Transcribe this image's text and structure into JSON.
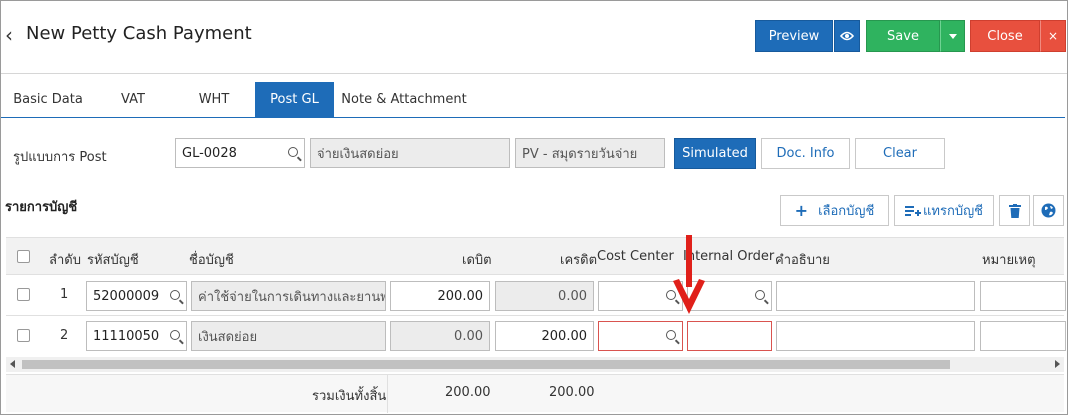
{
  "header": {
    "back_icon": "‹",
    "title": "New Petty Cash Payment",
    "preview_label": "Preview",
    "save_label": "Save",
    "close_label": "Close",
    "close_x": "×"
  },
  "tabs": [
    {
      "label": "Basic Data"
    },
    {
      "label": "VAT"
    },
    {
      "label": "WHT"
    },
    {
      "label": "Post GL",
      "active": true
    },
    {
      "label": "Note & Attachment"
    }
  ],
  "post": {
    "label": "รูปแบบการ Post",
    "code": "GL-0028",
    "description": "จ่ายเงินสดย่อย",
    "journal": "PV - สมุดรายวันจ่าย",
    "simulated_label": "Simulated",
    "docinfo_label": "Doc. Info",
    "clear_label": "Clear"
  },
  "accounts": {
    "title": "รายการบัญชี",
    "select_label": "เลือกบัญชี",
    "insert_label": "แทรกบัญชี"
  },
  "table": {
    "headers": {
      "seq": "ลำดับ",
      "code": "รหัสบัญชี",
      "name": "ชื่อบัญชี",
      "debit": "เดบิต",
      "credit": "เครดิต",
      "cost_center": "Cost Center",
      "internal_order": "Internal Order",
      "description": "คำอธิบาย",
      "remark": "หมายเหตุ"
    },
    "rows": [
      {
        "seq": "1",
        "code": "52000009",
        "name": "ค่าใช้จ่ายในการเดินทางและยานพาหนะ",
        "debit": "200.00",
        "credit": "0.00"
      },
      {
        "seq": "2",
        "code": "11110050",
        "name": "เงินสดย่อย",
        "debit": "0.00",
        "credit": "200.00"
      }
    ],
    "total_label": "รวมเงินทั้งสิ้น",
    "total_debit": "200.00",
    "total_credit": "200.00"
  },
  "colors": {
    "primary": "#1e6cb8",
    "success": "#2fb35f",
    "danger": "#e8503e",
    "annotation_arrow": "#e0201a",
    "error_border": "#d9534f"
  }
}
